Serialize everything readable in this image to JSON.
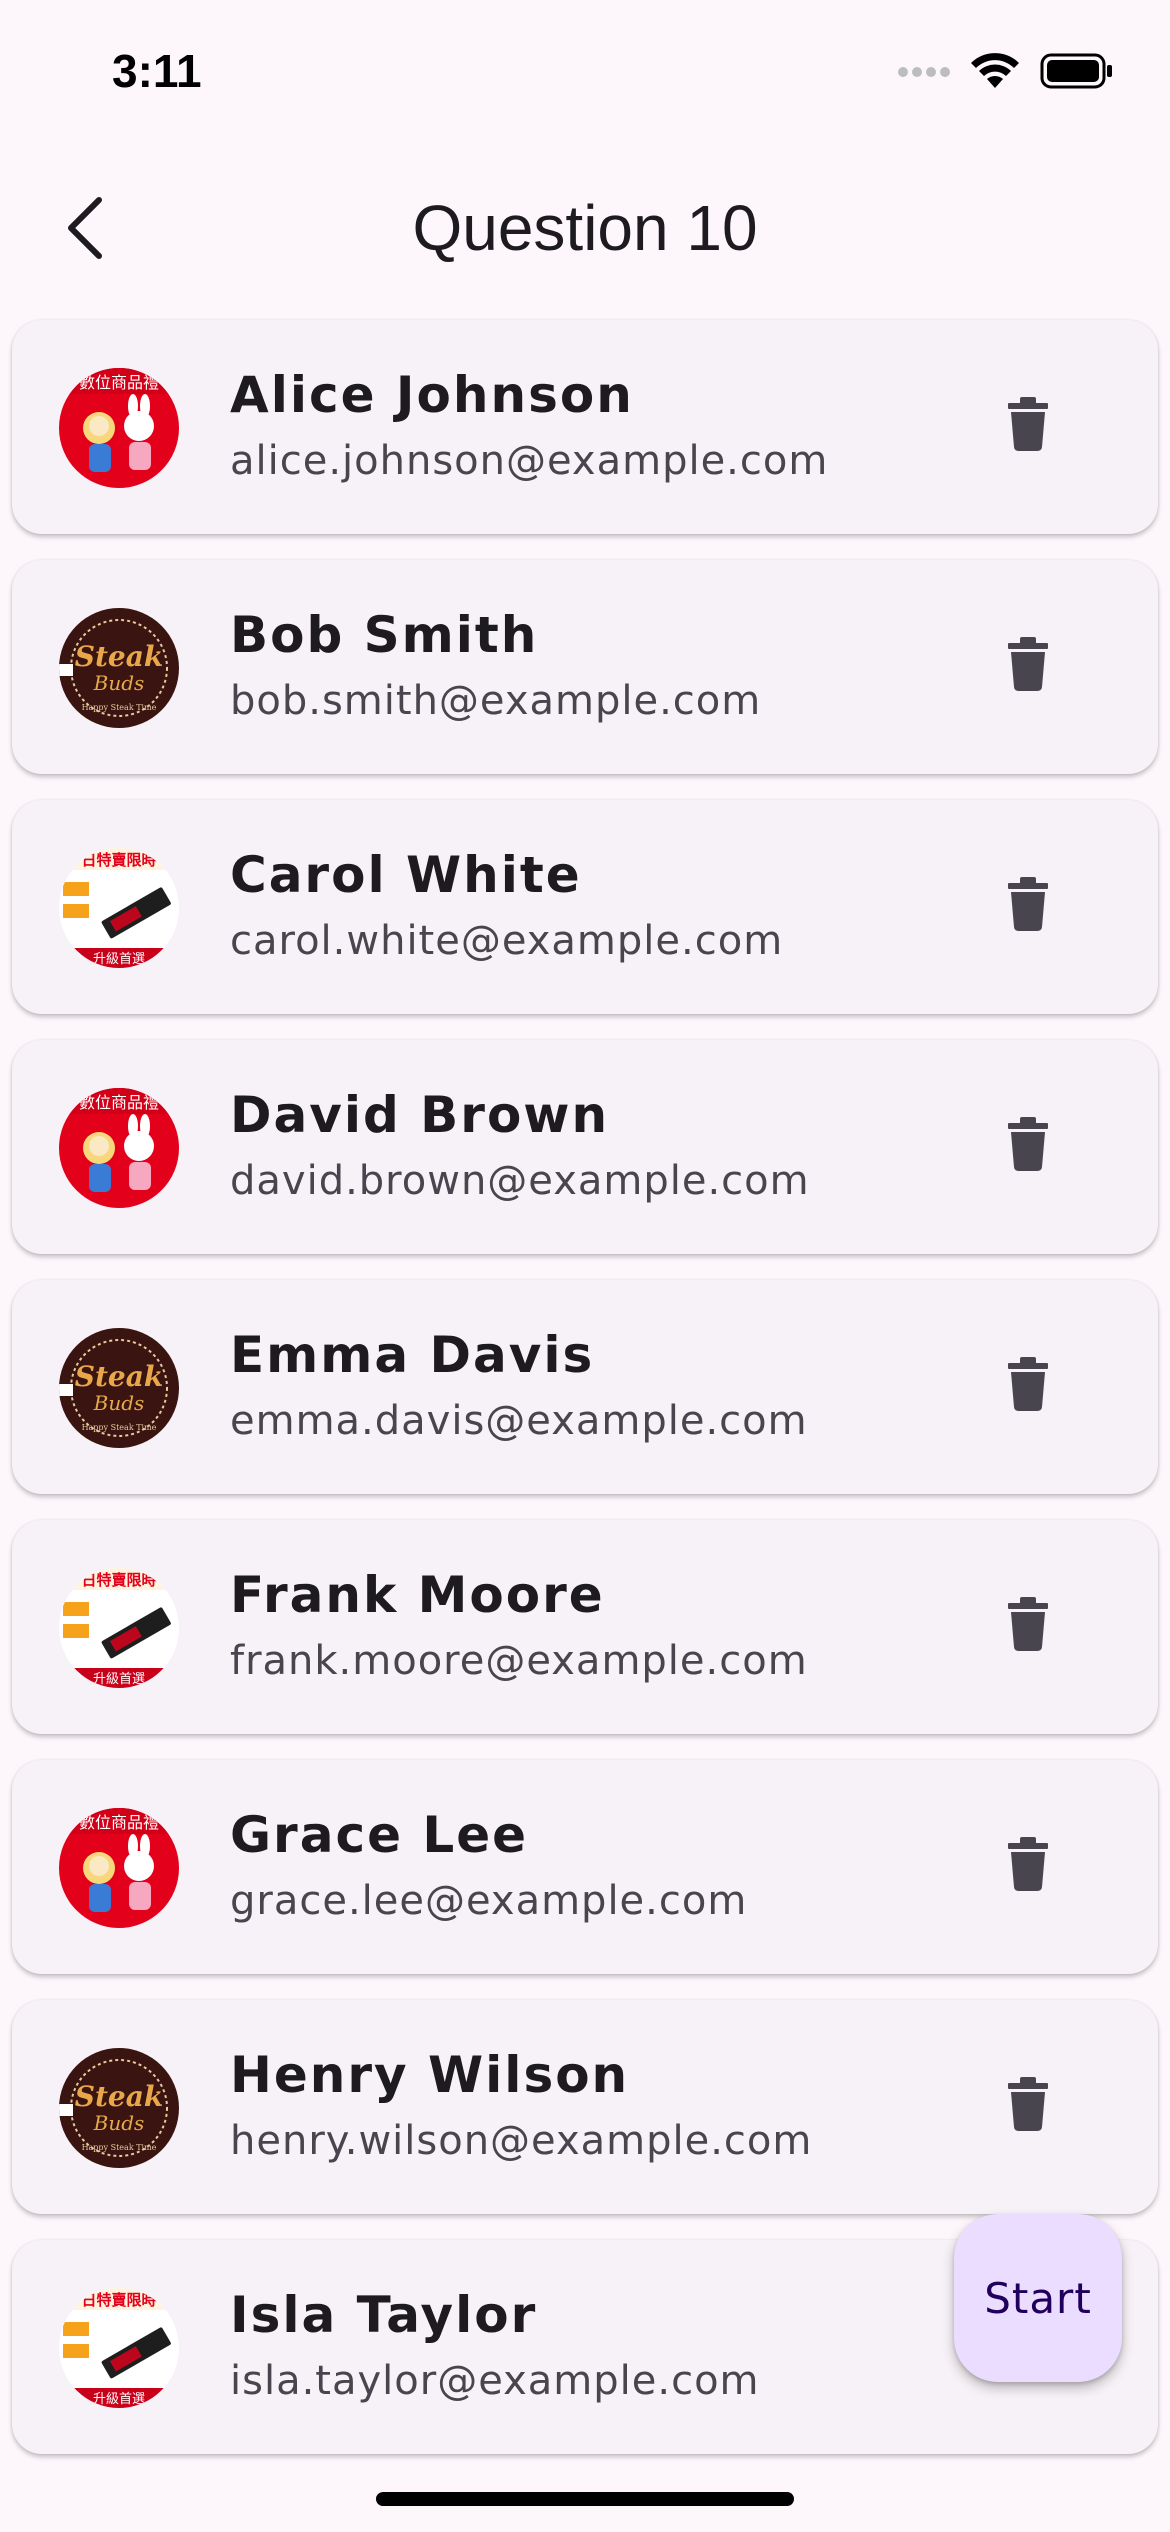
{
  "status_bar": {
    "time": "3:11"
  },
  "header": {
    "title": "Question 10",
    "back_icon": "chevron-left-icon"
  },
  "contacts": [
    {
      "name": "Alice Johnson",
      "email": "alice.johnson@example.com",
      "avatar": "red"
    },
    {
      "name": "Bob Smith",
      "email": "bob.smith@example.com",
      "avatar": "steak"
    },
    {
      "name": "Carol White",
      "email": "carol.white@example.com",
      "avatar": "ssd"
    },
    {
      "name": "David Brown",
      "email": "david.brown@example.com",
      "avatar": "red"
    },
    {
      "name": "Emma Davis",
      "email": "emma.davis@example.com",
      "avatar": "steak"
    },
    {
      "name": "Frank Moore",
      "email": "frank.moore@example.com",
      "avatar": "ssd"
    },
    {
      "name": "Grace Lee",
      "email": "grace.lee@example.com",
      "avatar": "red"
    },
    {
      "name": "Henry Wilson",
      "email": "henry.wilson@example.com",
      "avatar": "steak"
    },
    {
      "name": "Isla Taylor",
      "email": "isla.taylor@example.com",
      "avatar": "ssd"
    }
  ],
  "delete_icon": "trash-icon",
  "fab": {
    "label": "Start"
  },
  "colors": {
    "background": "#fdf7fc",
    "card": "#f7f2f7",
    "fab": "#eaddff",
    "icon": "#49454f"
  }
}
